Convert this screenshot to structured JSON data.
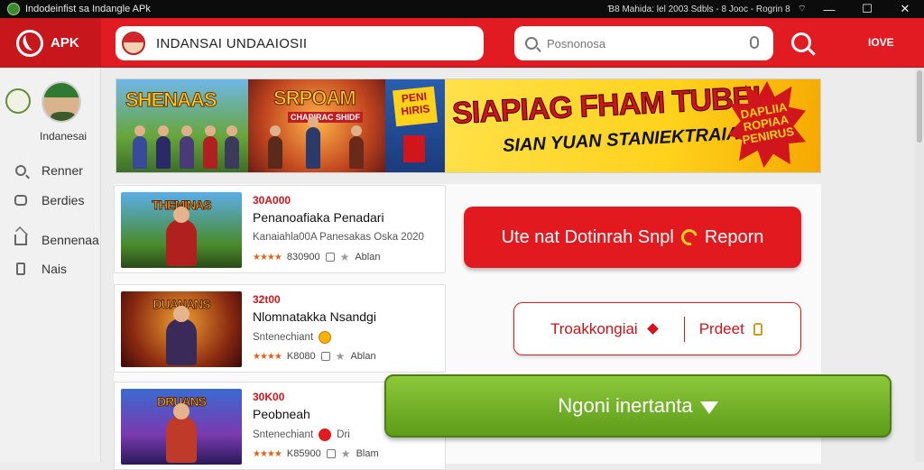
{
  "titlebar": {
    "title": "Indodeinfist sa  Indangle  APk",
    "status": "Ɓ8 Mahida: lel   2003   Sdbls - 8 Jooc - Rogrin 8",
    "minimize": "—",
    "maximize": "☐",
    "close": "✕"
  },
  "header": {
    "logo_text": "APK",
    "app_search_text": "INDANSAI  UNDAAIOSII",
    "web_search_placeholder": "Posnonosa",
    "more_label": "IOVE"
  },
  "sidebar": {
    "profile_name": "Indanesai",
    "items": [
      {
        "label": "Renner",
        "icon": "search-icon"
      },
      {
        "label": "Berdies",
        "icon": "cloud-icon"
      },
      {
        "label": "Bennenaa",
        "icon": "home-icon"
      },
      {
        "label": "Nais",
        "icon": "document-icon"
      }
    ]
  },
  "banner": {
    "panel1_title": "SHENAAS",
    "panel2_title": "SRPOAM",
    "panel2_sub": "CHAPIRAC SHIDF",
    "panel3_badge": "PENI HIRIS",
    "headline": "SIAPIAG FHAM TUBE!",
    "subline": "SIAN YUAN STANIEKTRAIA!",
    "burst_text": "DAPLIIA ROPIAA PENIRUS"
  },
  "cards": [
    {
      "price": "30A000",
      "title": "Penanoafiaka Penadari",
      "subtitle": "Kanaiahla00A Panesakas Oska 2020",
      "stars": "★★★★",
      "rating_count": "830900",
      "tag": "Ablan",
      "thumb_title": "THEMINAS"
    },
    {
      "price": "32t00",
      "title": "Nlomnatakka Nsandgi",
      "subtitle": "Sntenechiant",
      "stars": "★★★★",
      "rating_count": "K8080",
      "tag": "Ablan",
      "thumb_title": "DUANANS"
    },
    {
      "price": "30K00",
      "title": "Peobneah",
      "subtitle": "Sntenechiant",
      "stars": "★★★★",
      "rating_count": "K85900",
      "tag": "Blam",
      "extra": "Dri",
      "thumb_title": "DRUANS"
    }
  ],
  "actions": {
    "update_text": "Ute nat Dotinrah Snpl",
    "update_report": "Reporn",
    "recommend_text": "Troakkongiai",
    "recommend_report": "Prdeet",
    "install_text": "Ngoni inertanta"
  },
  "colors": {
    "brand_red": "#e21b23",
    "install_green": "#6fae24",
    "accent_yellow": "#ffd21c"
  }
}
